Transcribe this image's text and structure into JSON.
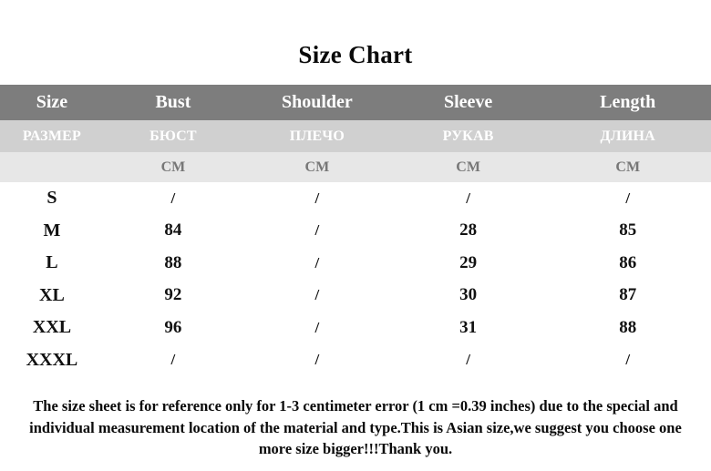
{
  "title": "Size Chart",
  "table": {
    "headers_en": [
      "Size",
      "Bust",
      "Shoulder",
      "Sleeve",
      "Length"
    ],
    "headers_ru": [
      "РАЗМЕР",
      "БЮСТ",
      "ПЛЕЧО",
      "РУКАВ",
      "ДЛИНА"
    ],
    "units": [
      "",
      "CM",
      "CM",
      "CM",
      "CM"
    ],
    "rows": [
      [
        "S",
        "/",
        "/",
        "/",
        "/"
      ],
      [
        "M",
        "84",
        "/",
        "28",
        "85"
      ],
      [
        "L",
        "88",
        "/",
        "29",
        "86"
      ],
      [
        "XL",
        "92",
        "/",
        "30",
        "87"
      ],
      [
        "XXL",
        "96",
        "/",
        "31",
        "88"
      ],
      [
        "XXXL",
        "/",
        "/",
        "/",
        "/"
      ]
    ]
  },
  "footer": {
    "note": "The size sheet is for reference only for 1-3 centimeter error (1 cm =0.39 inches) due to the special and individual measurement location of the material and type.This is Asian size,we suggest you choose one more size bigger!!!Thank you."
  },
  "colors": {
    "header_en_bg": "#7d7d7d",
    "header_ru_bg": "#d0d0d0",
    "header_unit_bg": "#e7e7e7",
    "header_text": "#ffffff",
    "unit_text": "#777777",
    "body_text": "#111111",
    "page_bg": "#ffffff"
  }
}
